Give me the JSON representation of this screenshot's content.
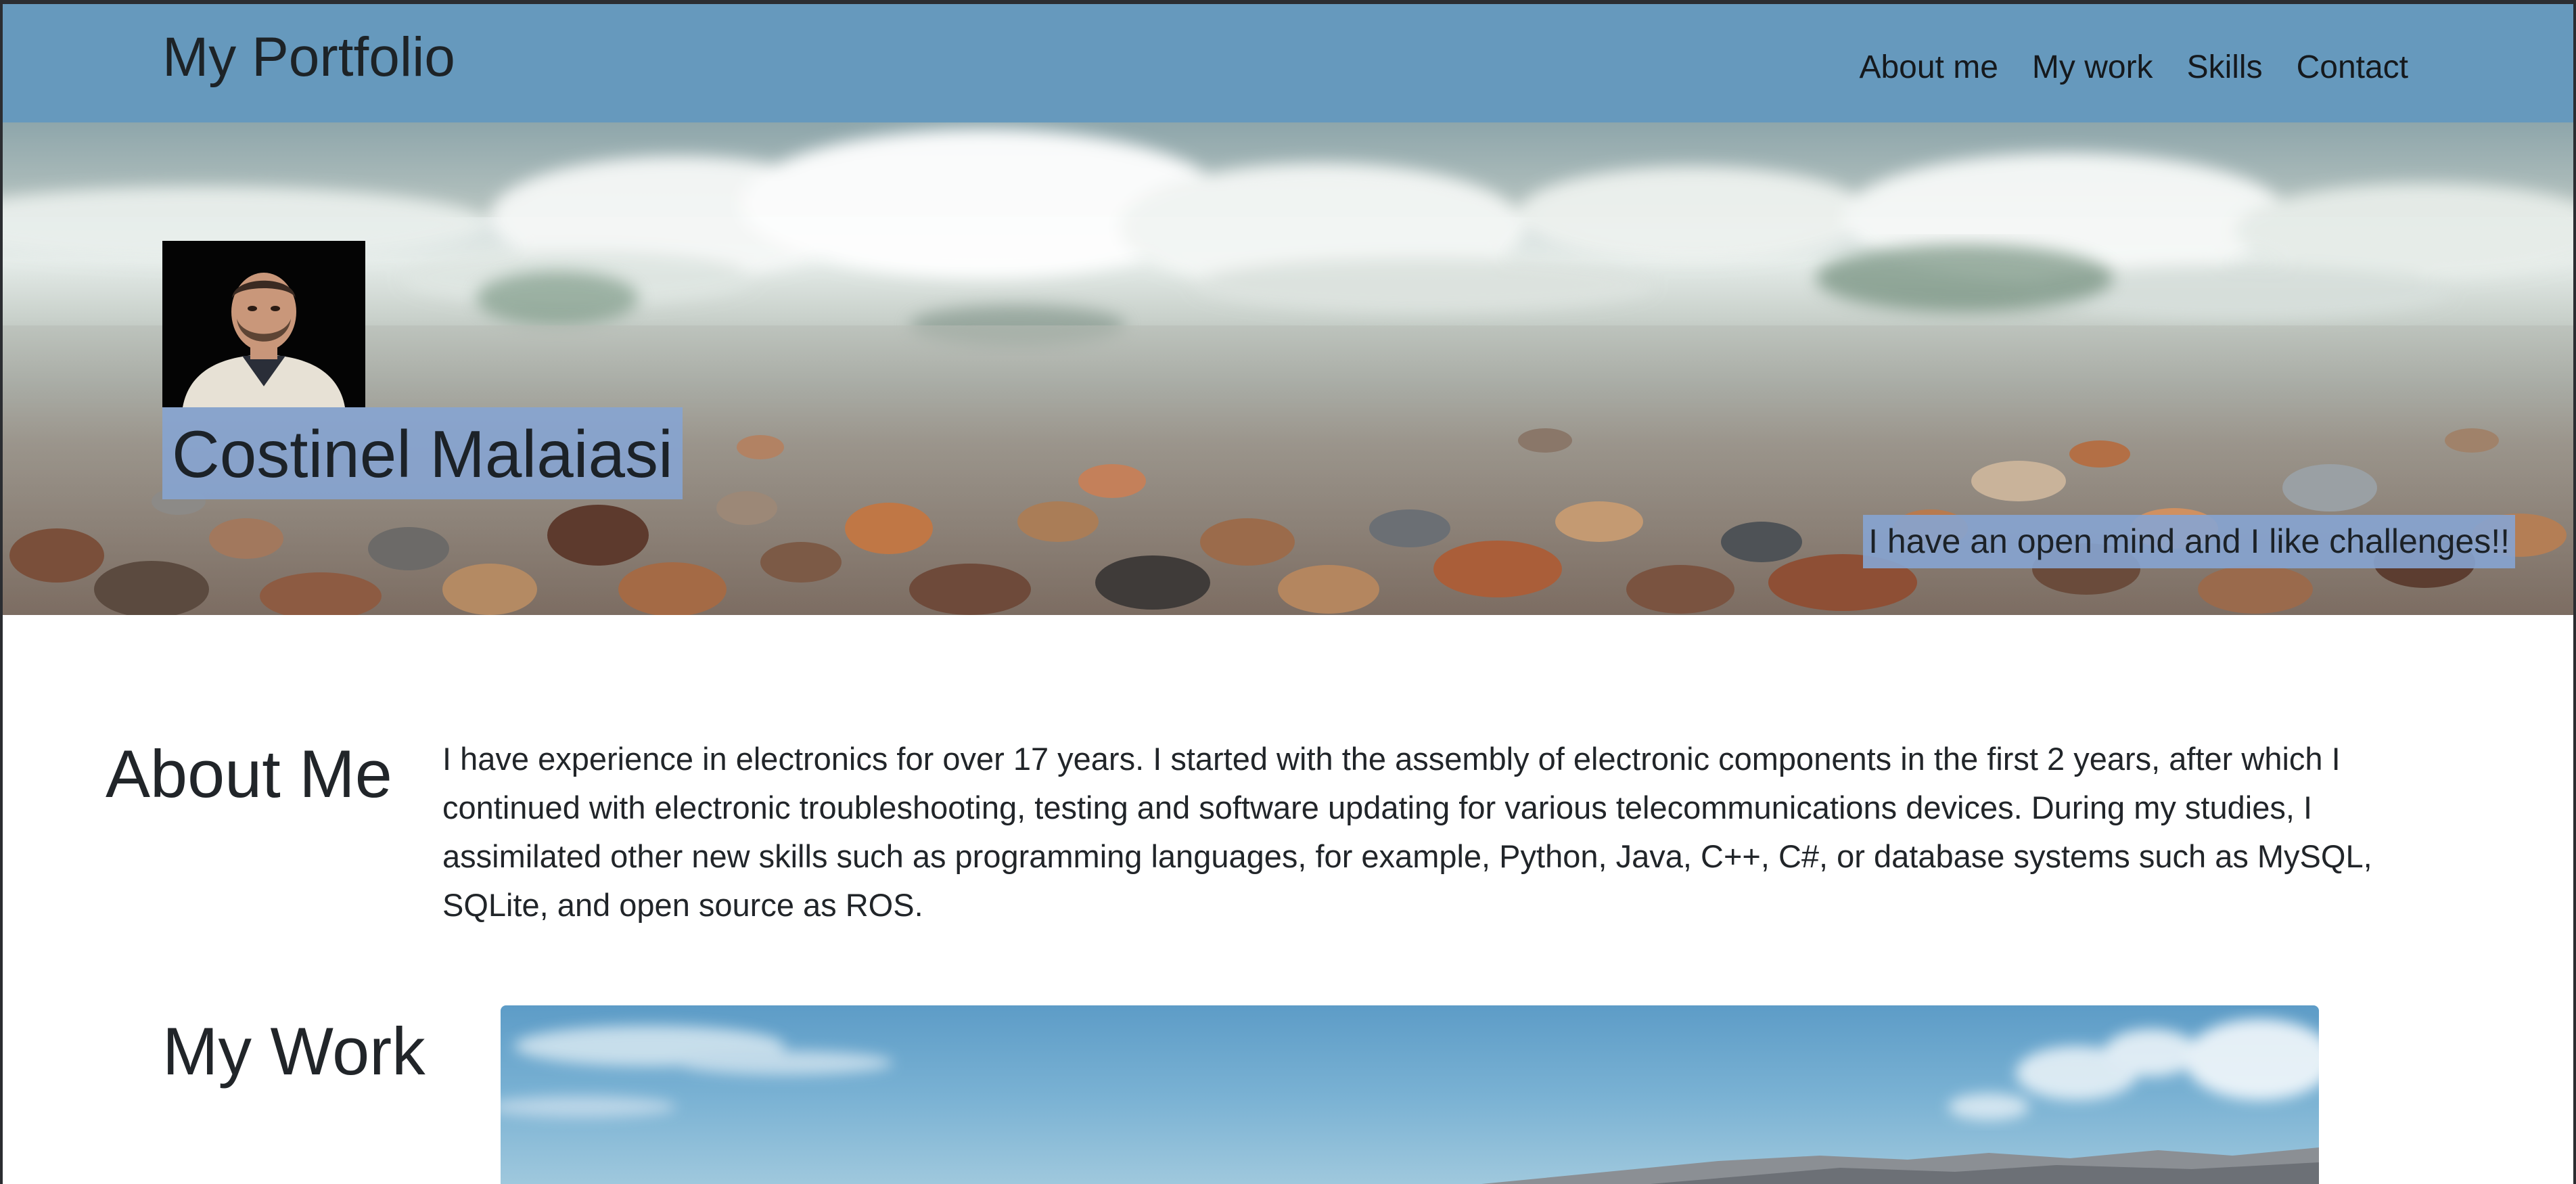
{
  "navbar": {
    "brand": "My Portfolio",
    "links": [
      "About me",
      "My work",
      "Skills",
      "Contact"
    ]
  },
  "hero": {
    "name": "Costinel Malaiasi",
    "tagline": "I have an open mind and I like challenges!!"
  },
  "about": {
    "heading": "About Me",
    "text": "I have experience in electronics for over 17 years. I started with the assembly of electronic components in the first 2 years, after which I continued with electronic troubleshooting, testing and software updating for various telecommunications devices. During my studies, I assimilated other new skills such as programming languages, for example, Python, Java, C++, C#, or database systems such as MySQL, SQLite, and open source as ROS."
  },
  "work": {
    "heading": "My Work"
  },
  "colors": {
    "navbar_bg": "#6699bd",
    "label_bg": "#86a4d2",
    "text": "#212529"
  }
}
